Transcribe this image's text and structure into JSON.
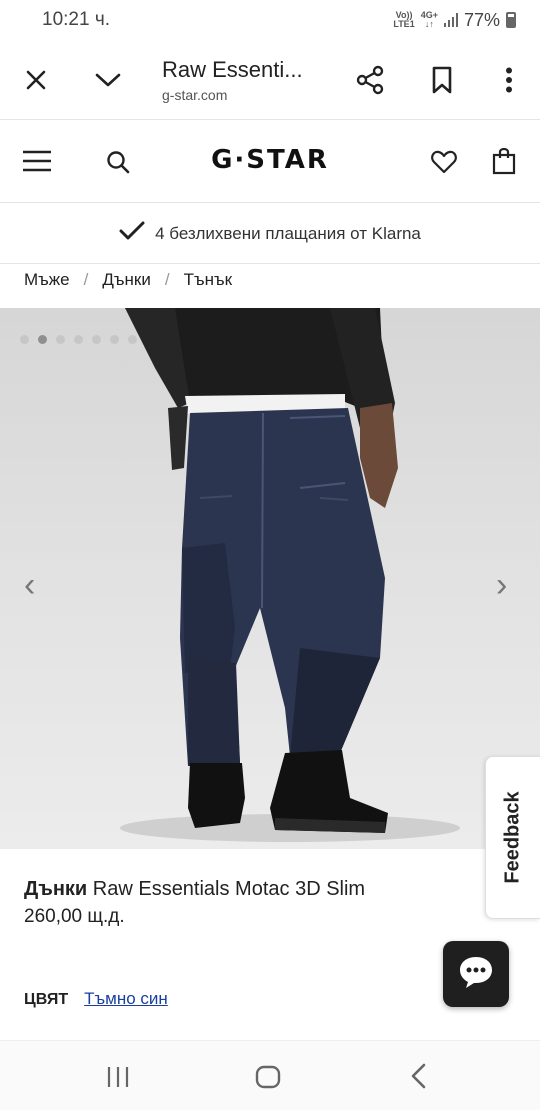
{
  "status_bar": {
    "time": "10:21 ч.",
    "network_top": "Vo))",
    "network_bottom": "LTE1",
    "network_type": "4G+",
    "battery": "77%"
  },
  "custom_tab": {
    "title": "Raw Essenti...",
    "url": "g-star.com",
    "icons": [
      "close-icon",
      "chevron-down-icon",
      "share-icon",
      "bookmark-icon",
      "more-vert-icon"
    ]
  },
  "site_header": {
    "logo": "G·STAR",
    "icons": [
      "menu-icon",
      "search-icon",
      "heart-icon",
      "shopping-bag-icon"
    ]
  },
  "promo": {
    "text": "4 безлихвени плащания от Klarna",
    "icon": "checkmark-icon"
  },
  "breadcrumb": [
    {
      "label": "Мъже"
    },
    {
      "label": "Дънки"
    },
    {
      "label": "Тънък"
    }
  ],
  "breadcrumb_separator": "/",
  "gallery": {
    "slide_count": 7,
    "active_slide": 2,
    "prev_arrow": "‹",
    "next_arrow": "›"
  },
  "feedback": {
    "label": "Feedback"
  },
  "product": {
    "category": "Дънки",
    "name": "Raw Essentials Motac 3D Slim",
    "price": "260,00 щ.д.",
    "color_label": "ЦВЯТ",
    "color_value": "Тъмно син"
  },
  "chat": {
    "icon": "chat-bubble-icon"
  },
  "nav_bar": {
    "icons": [
      "recents-icon",
      "home-icon",
      "back-icon"
    ]
  },
  "colors": {
    "link": "#1a3fa0",
    "text": "#222222",
    "chat_bg": "#1f1f1f",
    "denim": "#2b3550"
  }
}
